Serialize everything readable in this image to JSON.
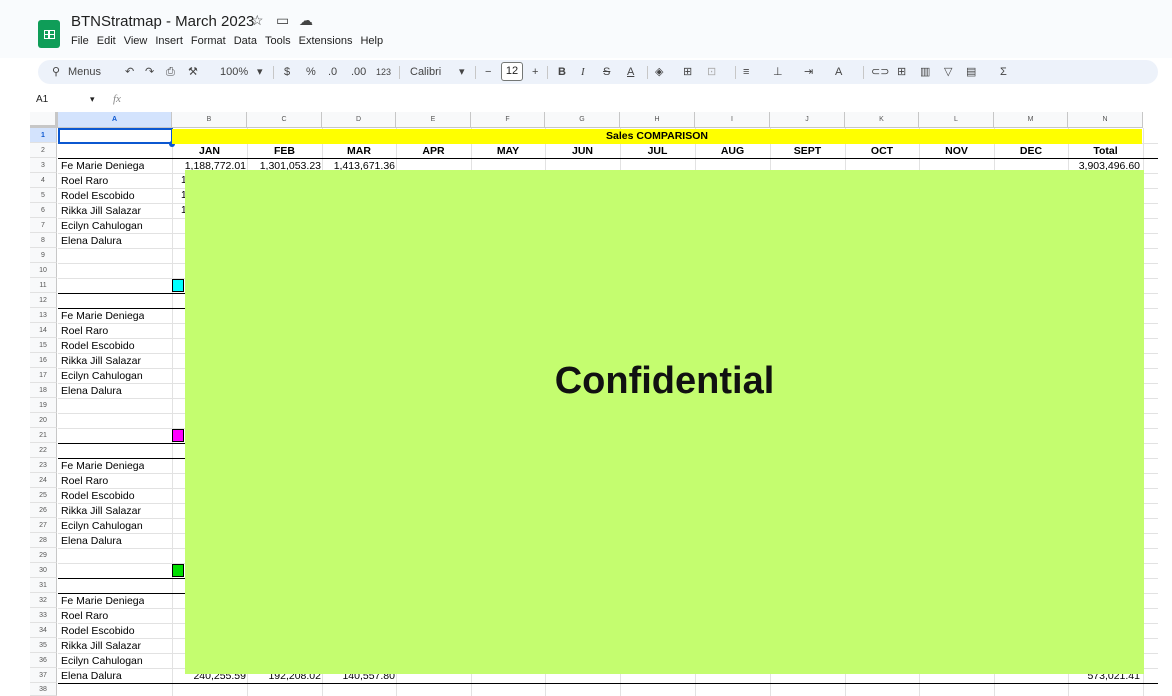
{
  "app": {
    "title": "BTNStratmap - March 2023",
    "menu": [
      "File",
      "Edit",
      "View",
      "Insert",
      "Format",
      "Data",
      "Tools",
      "Extensions",
      "Help"
    ]
  },
  "toolbar": {
    "menus_label": "Menus",
    "zoom": "100%",
    "currency": "$",
    "percent": "%",
    "dec_decrease": ".0",
    "dec_increase": ".00",
    "format_123": "123",
    "font": "Calibri",
    "font_size": "12",
    "bold": "B",
    "italic": "I",
    "text_color": "A",
    "sigma": "Σ"
  },
  "formula_bar": {
    "name_box": "A1",
    "fx": "fx"
  },
  "columns": [
    "A",
    "B",
    "C",
    "D",
    "E",
    "F",
    "G",
    "H",
    "I",
    "J",
    "K",
    "L",
    "M",
    "N"
  ],
  "rows": [
    "1",
    "2",
    "3",
    "4",
    "5",
    "6",
    "7",
    "8",
    "9",
    "10",
    "11",
    "12",
    "13",
    "14",
    "15",
    "16",
    "17",
    "18",
    "19",
    "20",
    "21",
    "22",
    "23",
    "24",
    "25",
    "26",
    "27",
    "28",
    "29",
    "30",
    "31",
    "32",
    "33",
    "34",
    "35",
    "36",
    "37",
    "38"
  ],
  "sheet": {
    "banner": "Sales COMPARISON",
    "months": [
      "JAN",
      "FEB",
      "MAR",
      "APR",
      "MAY",
      "JUN",
      "JUL",
      "AUG",
      "SEPT",
      "OCT",
      "NOV",
      "DEC",
      "Total"
    ],
    "row3_values": [
      "1,188,772.01",
      "1,301,053.23",
      "1,413,671.36"
    ],
    "row3_total": "3,903,496.60",
    "row37_values": [
      "240,255.59",
      "192,208.02",
      "140,557.80"
    ],
    "row37_total": "573,021.41",
    "blocks": [
      [
        "Fe Marie Deniega",
        "Roel Raro",
        "Rodel Escobido",
        "Rikka Jill Salazar",
        "Ecilyn Cahulogan",
        "Elena Dalura"
      ],
      [
        "Fe Marie Deniega",
        "Roel Raro",
        "Rodel Escobido",
        "Rikka Jill Salazar",
        "Ecilyn Cahulogan",
        "Elena Dalura"
      ],
      [
        "Fe Marie Deniega",
        "Roel Raro",
        "Rodel Escobido",
        "Rikka Jill Salazar",
        "Ecilyn Cahulogan",
        "Elena Dalura"
      ],
      [
        "Fe Marie Deniega",
        "Roel Raro",
        "Rodel Escobido",
        "Rikka Jill Salazar",
        "Ecilyn Cahulogan",
        "Elena Dalura"
      ]
    ],
    "swatch_colors": [
      "#00ffff",
      "#ff00ff",
      "#00dd00"
    ]
  },
  "overlay": {
    "label": "Confidential",
    "color": "#c4fd6f"
  },
  "icons": [
    "star-icon",
    "move-folder-icon",
    "cloud-status-icon",
    "search-icon",
    "undo-icon",
    "redo-icon",
    "print-icon",
    "paint-format-icon",
    "fill-color-icon",
    "borders-icon",
    "merge-icon",
    "link-icon",
    "comment-icon",
    "chart-icon",
    "filter-icon",
    "functions-icon"
  ]
}
